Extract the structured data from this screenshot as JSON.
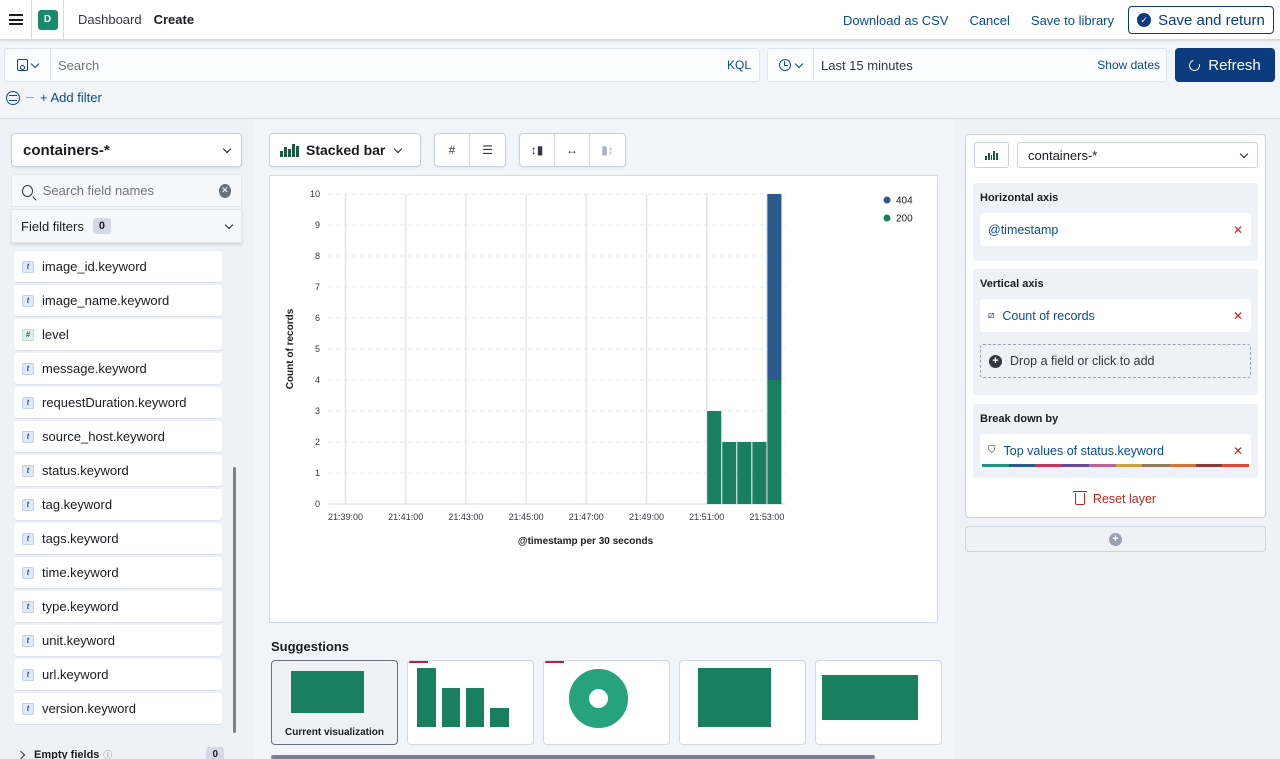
{
  "header": {
    "space_initial": "D",
    "breadcrumbs": [
      "Dashboard",
      "Create"
    ],
    "actions": {
      "download_csv": "Download as CSV",
      "cancel": "Cancel",
      "save_to_library": "Save to library",
      "save_and_return": "Save and return"
    }
  },
  "query": {
    "search_placeholder": "Search",
    "language": "KQL",
    "time_range": "Last 15 minutes",
    "show_dates": "Show dates",
    "refresh": "Refresh",
    "add_filter": "+ Add filter"
  },
  "sidebar": {
    "index_pattern": "containers-*",
    "field_search_placeholder": "Search field names",
    "field_filters_label": "Field filters",
    "field_filters_count": "0",
    "fields": [
      {
        "name": "image_id.keyword",
        "type": "t"
      },
      {
        "name": "image_name.keyword",
        "type": "t"
      },
      {
        "name": "level",
        "type": "#"
      },
      {
        "name": "message.keyword",
        "type": "t"
      },
      {
        "name": "requestDuration.keyword",
        "type": "t"
      },
      {
        "name": "source_host.keyword",
        "type": "t"
      },
      {
        "name": "status.keyword",
        "type": "t"
      },
      {
        "name": "tag.keyword",
        "type": "t"
      },
      {
        "name": "tags.keyword",
        "type": "t"
      },
      {
        "name": "time.keyword",
        "type": "t"
      },
      {
        "name": "type.keyword",
        "type": "t"
      },
      {
        "name": "unit.keyword",
        "type": "t"
      },
      {
        "name": "url.keyword",
        "type": "t"
      },
      {
        "name": "version.keyword",
        "type": "t"
      }
    ],
    "empty_fields_label": "Empty fields",
    "empty_fields_count": "0"
  },
  "workspace": {
    "vis_type": "Stacked bar",
    "suggestions_title": "Suggestions",
    "current_visualization_label": "Current visualization"
  },
  "chart_data": {
    "type": "bar",
    "stacked": true,
    "title": "",
    "xlabel": "@timestamp per 30 seconds",
    "ylabel": "Count of records",
    "ylim": [
      0,
      10
    ],
    "yticks": [
      0,
      1,
      2,
      3,
      4,
      5,
      6,
      7,
      8,
      9,
      10
    ],
    "xtick_labels": [
      "21:39:00",
      "21:41:00",
      "21:43:00",
      "21:45:00",
      "21:47:00",
      "21:49:00",
      "21:51:00",
      "21:53:00"
    ],
    "categories": [
      "21:51:00",
      "21:51:30",
      "21:52:00",
      "21:52:30",
      "21:53:00"
    ],
    "series": [
      {
        "name": "200",
        "color": "#1a7f5f",
        "values": [
          3,
          2,
          2,
          2,
          4
        ]
      },
      {
        "name": "404",
        "color": "#2a5b8f",
        "values": [
          0,
          0,
          0,
          0,
          6
        ]
      }
    ],
    "legend": {
      "position": "top-right",
      "entries": [
        "404",
        "200"
      ]
    },
    "grid": true
  },
  "config": {
    "layer_index": "containers-*",
    "horizontal_axis_label": "Horizontal axis",
    "horizontal_axis_value": "@timestamp",
    "vertical_axis_label": "Vertical axis",
    "vertical_axis_value": "Count of records",
    "drop_field_text": "Drop a field or click to add",
    "breakdown_label": "Break down by",
    "breakdown_value": "Top values of status.keyword",
    "reset_layer": "Reset layer",
    "palette": [
      "#209280",
      "#2a5b8f",
      "#c3355f",
      "#6a4a95",
      "#b8649a",
      "#c9a33c",
      "#8f7b58",
      "#d0763b",
      "#8a3b35",
      "#e0493a"
    ]
  }
}
